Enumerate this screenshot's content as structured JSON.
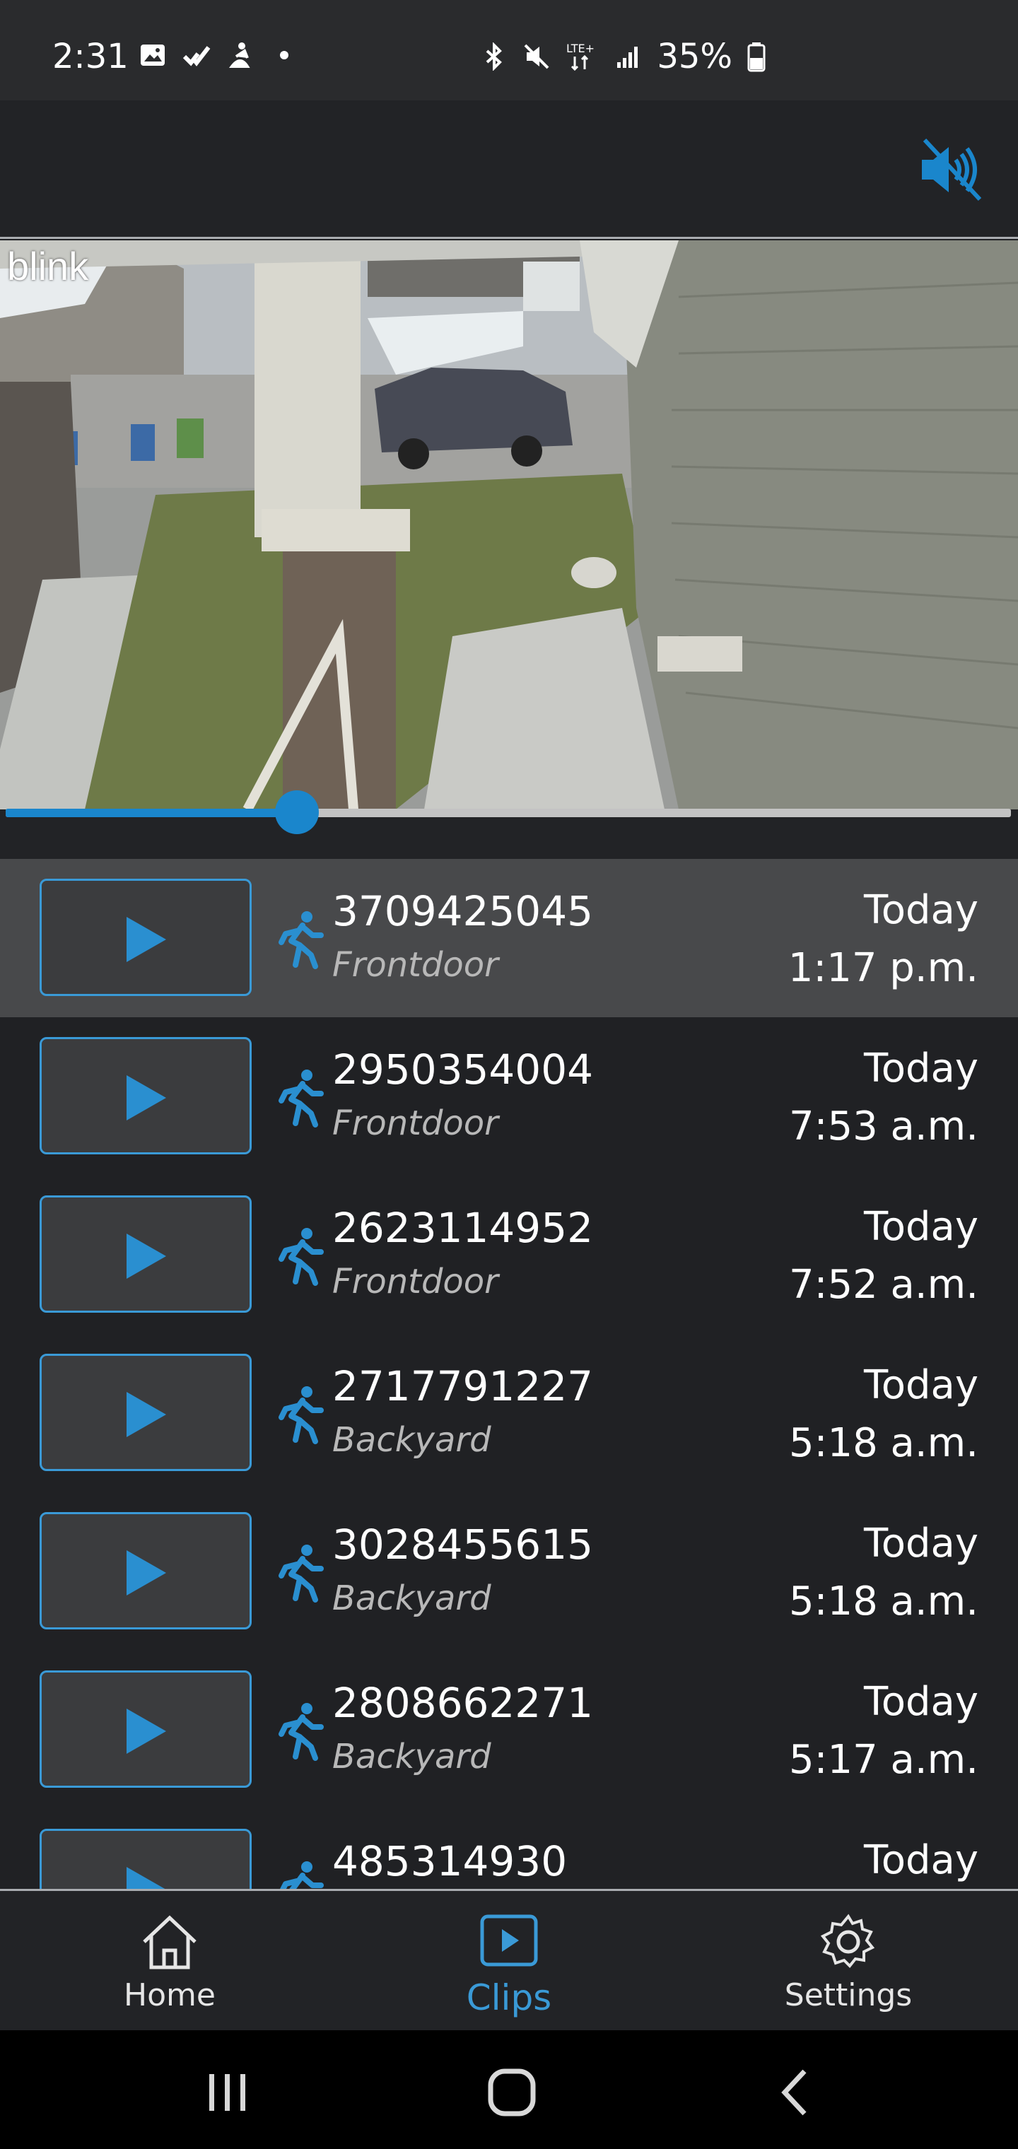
{
  "status_bar": {
    "time": "2:31",
    "network": "LTE+",
    "battery": "35%",
    "left_icons": [
      "gallery-icon",
      "checkmark-icon",
      "fitness-icon",
      "dot-icon"
    ],
    "right_icons": [
      "bluetooth-icon",
      "mute-icon",
      "lte-icon",
      "signal-icon",
      "battery-icon"
    ]
  },
  "app_bar": {
    "mute_icon": "speaker-muted-icon"
  },
  "video": {
    "brand": "blink",
    "playback_progress": 0.29
  },
  "clips": [
    {
      "id": "3709425045",
      "camera": "Frontdoor",
      "day": "Today",
      "time": "1:17 p.m.",
      "selected": true
    },
    {
      "id": "2950354004",
      "camera": "Frontdoor",
      "day": "Today",
      "time": "7:53 a.m.",
      "selected": false
    },
    {
      "id": "2623114952",
      "camera": "Frontdoor",
      "day": "Today",
      "time": "7:52 a.m.",
      "selected": false
    },
    {
      "id": "2717791227",
      "camera": "Backyard",
      "day": "Today",
      "time": "5:18 a.m.",
      "selected": false
    },
    {
      "id": "3028455615",
      "camera": "Backyard",
      "day": "Today",
      "time": "5:18 a.m.",
      "selected": false
    },
    {
      "id": "2808662271",
      "camera": "Backyard",
      "day": "Today",
      "time": "5:17 a.m.",
      "selected": false
    },
    {
      "id": "485314930",
      "camera": "",
      "day": "Today",
      "time": "",
      "selected": false
    }
  ],
  "nav": {
    "home": "Home",
    "clips": "Clips",
    "settings": "Settings",
    "active": "clips"
  },
  "colors": {
    "accent": "#1a86cc",
    "background": "#202124",
    "selected_row": "#48494b"
  }
}
